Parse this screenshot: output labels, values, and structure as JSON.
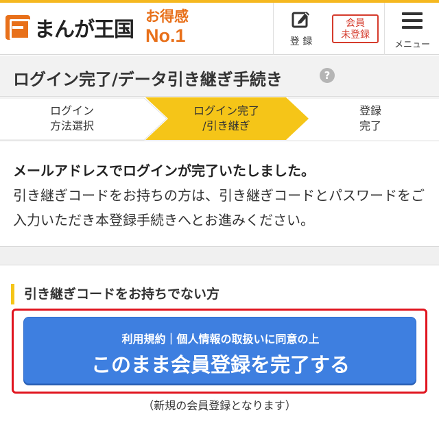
{
  "header": {
    "logo_text": "まんが王国",
    "badge_line1": "お得感",
    "badge_line2": "No.1",
    "register_label": "登 録",
    "member_status_line1": "会員",
    "member_status_line2": "未登録",
    "menu_label": "メニュー"
  },
  "page": {
    "title": "ログイン完了/データ引き継ぎ手続き",
    "help_icon": "?"
  },
  "steps": [
    {
      "line1": "ログイン",
      "line2": "方法選択",
      "active": false
    },
    {
      "line1": "ログイン完了",
      "line2": "/引き継ぎ",
      "active": true
    },
    {
      "line1": "登録",
      "line2": "完了",
      "active": false
    }
  ],
  "message": {
    "headline": "メールアドレスでログインが完了いたしました。",
    "body": "引き継ぎコードをお持ちの方は、引き継ぎコードとパスワードをご入力いただき本登録手続きへとお進みください。"
  },
  "section": {
    "title": "引き継ぎコードをお持ちでない方",
    "button_sub": "利用規約｜個人情報の取扱いに同意の上",
    "button_main": "このまま会員登録を完了する",
    "note": "（新規の会員登録となります）"
  },
  "colors": {
    "brand_orange": "#e8701a",
    "accent_yellow": "#f5c518",
    "cta_blue": "#3e7fe0",
    "highlight_red": "#e0141e"
  }
}
